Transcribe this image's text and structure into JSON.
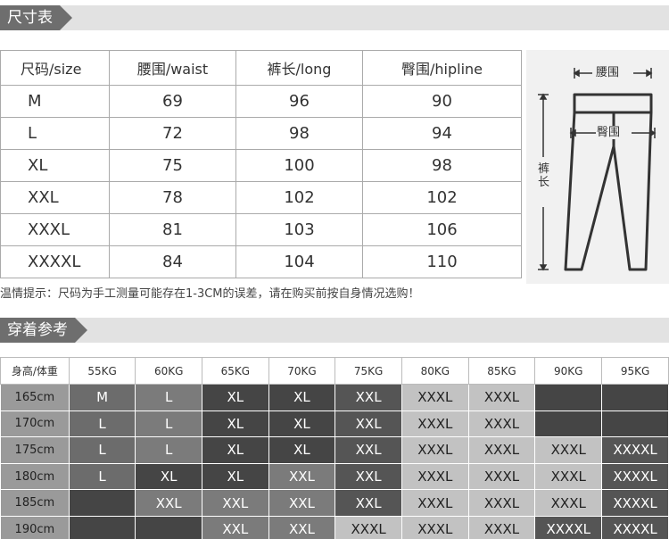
{
  "size_section": {
    "title": "尺寸表"
  },
  "size_table": {
    "headers": [
      "尺码/size",
      "腰围/waist",
      "裤长/long",
      "臀围/hipline"
    ],
    "rows": [
      [
        "M",
        "69",
        "96",
        "90"
      ],
      [
        "L",
        "72",
        "98",
        "94"
      ],
      [
        "XL",
        "75",
        "100",
        "98"
      ],
      [
        "XXL",
        "78",
        "102",
        "102"
      ],
      [
        "XXXL",
        "81",
        "103",
        "106"
      ],
      [
        "XXXXL",
        "84",
        "104",
        "110"
      ]
    ]
  },
  "diagram": {
    "waist_label": "腰围",
    "hip_label": "臀围",
    "length_label": "裤长"
  },
  "tip": "温情提示：尺码为手工测量可能存在1-3CM的误差，请在购买前按自身情况选购！",
  "wear_section": {
    "title": "穿着参考"
  },
  "wear_table": {
    "corner": "身高/体重",
    "weights": [
      "55KG",
      "60KG",
      "65KG",
      "70KG",
      "75KG",
      "80KG",
      "85KG",
      "90KG",
      "95KG"
    ],
    "rows": [
      {
        "height": "165cm",
        "cells": [
          [
            "M",
            "t1"
          ],
          [
            "L",
            "t2"
          ],
          [
            "XL",
            "t3"
          ],
          [
            "XL",
            "t3"
          ],
          [
            "XXL",
            "t5"
          ],
          [
            "XXXL",
            "t4"
          ],
          [
            "XXXL",
            "t4"
          ],
          [
            "",
            "t3"
          ],
          [
            "",
            "t3"
          ]
        ]
      },
      {
        "height": "170cm",
        "cells": [
          [
            "L",
            "t1"
          ],
          [
            "L",
            "t2"
          ],
          [
            "XL",
            "t3"
          ],
          [
            "XL",
            "t3"
          ],
          [
            "XXL",
            "t5"
          ],
          [
            "XXXL",
            "t4"
          ],
          [
            "XXXL",
            "t4"
          ],
          [
            "",
            "t3"
          ],
          [
            "",
            "t3"
          ]
        ]
      },
      {
        "height": "175cm",
        "cells": [
          [
            "L",
            "t1"
          ],
          [
            "L",
            "t2"
          ],
          [
            "XL",
            "t3"
          ],
          [
            "XL",
            "t3"
          ],
          [
            "XXL",
            "t5"
          ],
          [
            "XXXL",
            "t4"
          ],
          [
            "XXXL",
            "t4"
          ],
          [
            "XXXL",
            "t4"
          ],
          [
            "XXXXL",
            "t5"
          ]
        ]
      },
      {
        "height": "180cm",
        "cells": [
          [
            "L",
            "t1"
          ],
          [
            "XL",
            "t3"
          ],
          [
            "XL",
            "t3"
          ],
          [
            "XXL",
            "t2"
          ],
          [
            "XXL",
            "t5"
          ],
          [
            "XXXL",
            "t4"
          ],
          [
            "XXXL",
            "t4"
          ],
          [
            "XXXL",
            "t4"
          ],
          [
            "XXXXL",
            "t5"
          ]
        ]
      },
      {
        "height": "185cm",
        "cells": [
          [
            "",
            "t3"
          ],
          [
            "XXL",
            "t2"
          ],
          [
            "XXL",
            "t2"
          ],
          [
            "XXL",
            "t2"
          ],
          [
            "XXL",
            "t5"
          ],
          [
            "XXXL",
            "t4"
          ],
          [
            "XXXL",
            "t4"
          ],
          [
            "XXXL",
            "t4"
          ],
          [
            "XXXXL",
            "t5"
          ]
        ]
      },
      {
        "height": "190cm",
        "cells": [
          [
            "",
            "t3"
          ],
          [
            "",
            "t3"
          ],
          [
            "XXL",
            "t2"
          ],
          [
            "XXL",
            "t2"
          ],
          [
            "XXXL",
            "t4"
          ],
          [
            "XXXL",
            "t4"
          ],
          [
            "XXXL",
            "t4"
          ],
          [
            "XXXXL",
            "t5"
          ],
          [
            "XXXXL",
            "t5"
          ]
        ]
      }
    ]
  }
}
